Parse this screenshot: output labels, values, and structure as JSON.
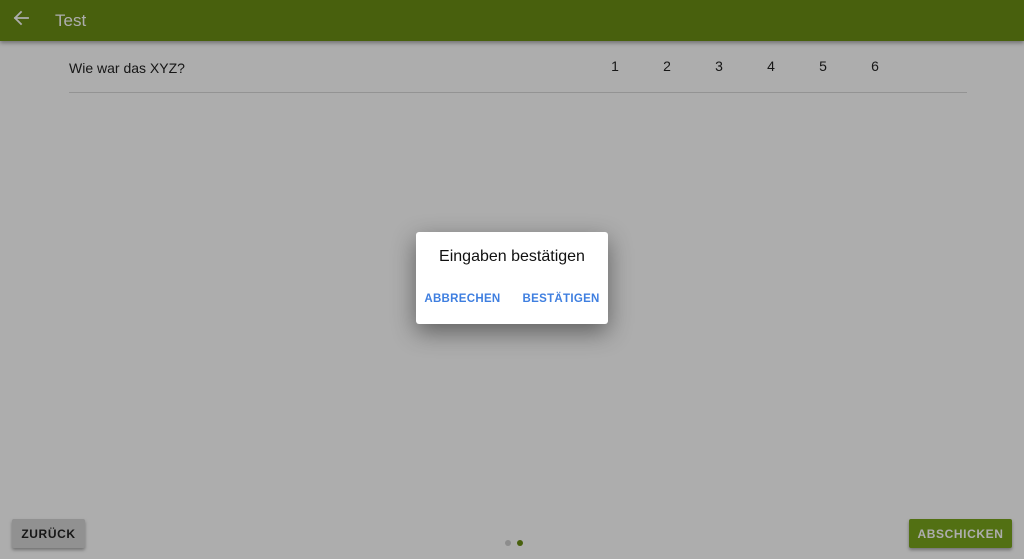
{
  "app_bar": {
    "title": "Test",
    "back_icon": "arrow-left-icon",
    "color": "#6b8e14"
  },
  "question": {
    "text": "Wie war das XYZ?",
    "options": [
      "1",
      "2",
      "3",
      "4",
      "5",
      "6"
    ]
  },
  "footer": {
    "back_label": "ZURÜCK",
    "submit_label": "ABSCHICKEN",
    "submit_color": "#7aa51c",
    "pager": {
      "pages": 2,
      "current": 2
    }
  },
  "dialog": {
    "title": "Eingaben bestätigen",
    "cancel_label": "ABBRECHEN",
    "confirm_label": "BESTÄTIGEN",
    "action_color": "#3f7fe0"
  }
}
